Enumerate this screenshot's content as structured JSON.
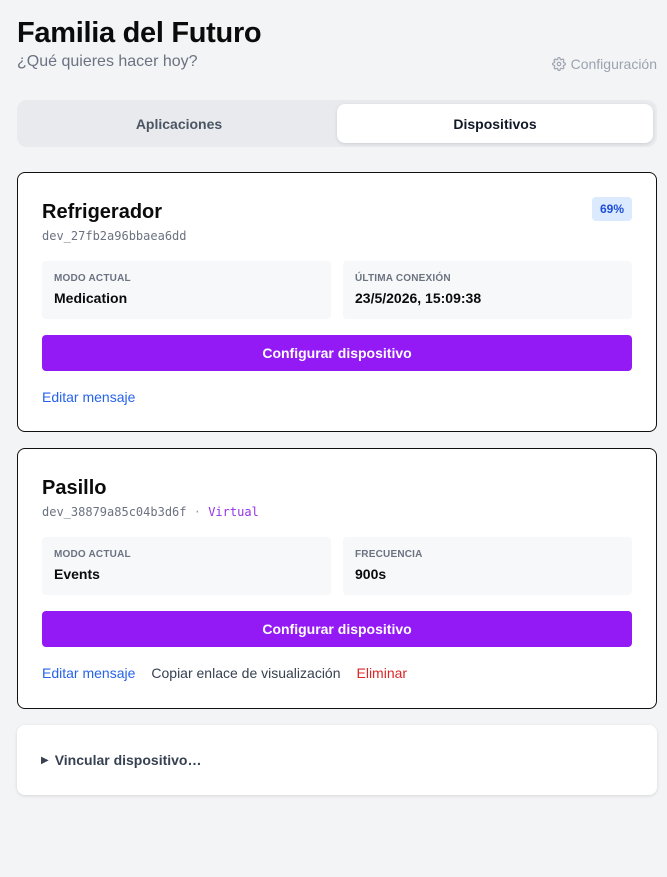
{
  "header": {
    "title": "Familia del Futuro",
    "subtitle": "¿Qué quieres hacer hoy?",
    "settings_label": "Configuración"
  },
  "tabs": [
    {
      "label": "Aplicaciones",
      "active": false
    },
    {
      "label": "Dispositivos",
      "active": true
    }
  ],
  "devices": [
    {
      "name": "Refrigerador",
      "id": "dev_27fb2a96bbaea6dd",
      "badge": "69%",
      "info": [
        {
          "label": "MODO ACTUAL",
          "value": "Medication"
        },
        {
          "label": "ÚLTIMA CONEXIÓN",
          "value": "23/5/2026, 15:09:38"
        }
      ],
      "configure_label": "Configurar dispositivo",
      "actions": [
        "Editar mensaje"
      ]
    },
    {
      "name": "Pasillo",
      "id": "dev_38879a85c04b3d6f",
      "separator": "·",
      "tag": "Virtual",
      "info": [
        {
          "label": "MODO ACTUAL",
          "value": "Events"
        },
        {
          "label": "FRECUENCIA",
          "value": "900s"
        }
      ],
      "configure_label": "Configurar dispositivo",
      "actions": [
        "Editar mensaje",
        "Copiar enlace de visualización",
        "Eliminar"
      ]
    }
  ],
  "link_device": {
    "label": "Vincular dispositivo…"
  },
  "icons": {
    "settings": "gear-icon",
    "expander": "triangle-right-icon"
  },
  "colors": {
    "accent": "#9319f5",
    "link": "#2563eb",
    "danger": "#dc2626",
    "badge_bg": "#dbeafe",
    "badge_text": "#1d4ed8",
    "virtual": "#9333ea"
  }
}
